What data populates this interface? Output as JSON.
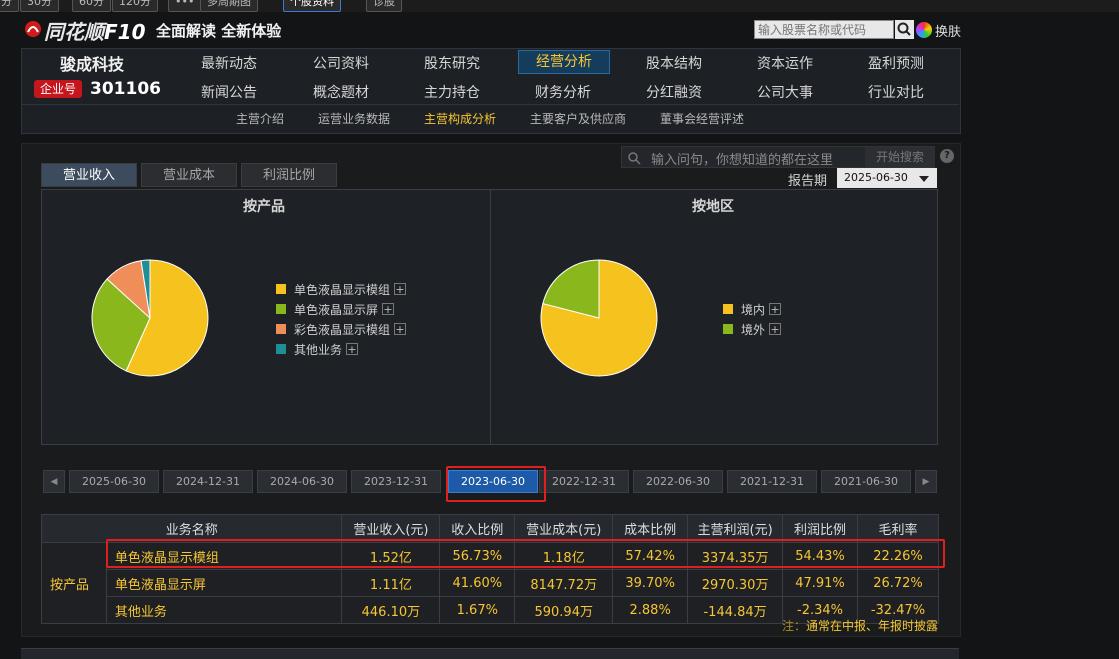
{
  "toolbar": {
    "items": [
      "分",
      "30分",
      "60分",
      "120分",
      "•••",
      "多周期图",
      "个股资料",
      "诊股"
    ]
  },
  "header": {
    "brand": "同花顺",
    "brand_suffix": "F10",
    "slogan": "全面解读 全新体验",
    "search_placeholder": "输入股票名称或代码",
    "skin_label": "换肤"
  },
  "company": {
    "name": "骏成科技",
    "badge": "企业号",
    "code": "301106"
  },
  "nav": {
    "row1": [
      "最新动态",
      "公司资料",
      "股东研究",
      "经营分析",
      "股本结构",
      "资本运作",
      "盈利预测"
    ],
    "row2": [
      "新闻公告",
      "概念题材",
      "主力持仓",
      "财务分析",
      "分红融资",
      "公司大事",
      "行业对比"
    ],
    "active": "经营分析"
  },
  "subnav": {
    "items": [
      "主营介绍",
      "运营业务数据",
      "主营构成分析",
      "主要客户及供应商",
      "董事会经营评述"
    ],
    "active": "主营构成分析"
  },
  "ask": {
    "placeholder": "输入问句，你想知道的都在这里",
    "button": "开始搜索",
    "help": "?"
  },
  "tabs": {
    "items": [
      "营业收入",
      "营业成本",
      "利润比例"
    ],
    "active": "营业收入"
  },
  "report_period": {
    "label": "报告期",
    "value": "2025-06-30"
  },
  "colors": {
    "yellow": "#f6c21d",
    "green": "#8ab81c",
    "orange": "#f08e5a",
    "teal": "#1f8f97"
  },
  "chart_data": [
    {
      "type": "pie",
      "title": "按产品",
      "series": [
        {
          "name": "单色液晶显示模组",
          "value": 56.73,
          "color": "#f6c21d"
        },
        {
          "name": "单色液晶显示屏",
          "value": 30.0,
          "color": "#8ab81c"
        },
        {
          "name": "彩色液晶显示模组",
          "value": 10.8,
          "color": "#f08e5a"
        },
        {
          "name": "其他业务",
          "value": 2.47,
          "color": "#1f8f97"
        }
      ]
    },
    {
      "type": "pie",
      "title": "按地区",
      "series": [
        {
          "name": "境内",
          "value": 79.0,
          "color": "#f6c21d"
        },
        {
          "name": "境外",
          "value": 21.0,
          "color": "#8ab81c"
        }
      ]
    }
  ],
  "periods": {
    "items": [
      "2025-06-30",
      "2024-12-31",
      "2024-06-30",
      "2023-12-31",
      "2023-06-30",
      "2022-12-31",
      "2022-06-30",
      "2021-12-31",
      "2021-06-30"
    ],
    "active": "2023-06-30",
    "prev": "◀",
    "next": "▶"
  },
  "table": {
    "headers": [
      "业务名称",
      "营业收入(元)",
      "收入比例",
      "营业成本(元)",
      "成本比例",
      "主营利润(元)",
      "利润比例",
      "毛利率"
    ],
    "category": "按产品",
    "rows": [
      [
        "单色液晶显示模组",
        "1.52亿",
        "56.73%",
        "1.18亿",
        "57.42%",
        "3374.35万",
        "54.43%",
        "22.26%"
      ],
      [
        "单色液晶显示屏",
        "1.11亿",
        "41.60%",
        "8147.72万",
        "39.70%",
        "2970.30万",
        "47.91%",
        "26.72%"
      ],
      [
        "其他业务",
        "446.10万",
        "1.67%",
        "590.94万",
        "2.88%",
        "-144.84万",
        "-2.34%",
        "-32.47%"
      ]
    ]
  },
  "note": {
    "prefix": "注：",
    "text": "通常在中报、年报时披露"
  }
}
